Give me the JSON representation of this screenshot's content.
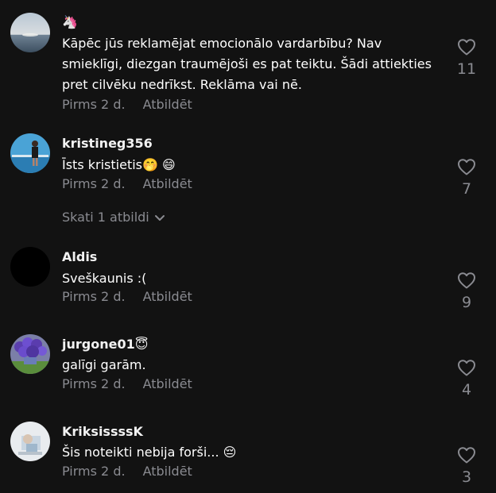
{
  "comments": [
    {
      "username": "🦄",
      "text": "Kāpēc jūs reklamējat emocionālo vardarbību? Nav smieklīgi, diezgan traumējoši es pat teiktu. Šādi attiekties pret cilvēku nedrīkst. Reklāma vai nē.",
      "time": "Pirms 2 d.",
      "reply": "Atbildēt",
      "likes": "11",
      "avatar": "sea-sunset"
    },
    {
      "username": "kristineg356",
      "text": "Īsts kristietis🤭 😄",
      "time": "Pirms 2 d.",
      "reply": "Atbildēt",
      "likes": "7",
      "avatar": "person-by-sea"
    },
    {
      "username": "Aldis",
      "text": "Sveškaunis :(",
      "time": "Pirms 2 d.",
      "reply": "Atbildēt",
      "likes": "9",
      "avatar": "black"
    },
    {
      "username": "jurgone01😇",
      "text": "galīgi garām.",
      "time": "Pirms 2 d.",
      "reply": "Atbildēt",
      "likes": "4",
      "avatar": "purple-flowers"
    },
    {
      "username": "KriksissssK",
      "text": "Šis noteikti nebija forši... 😔",
      "time": "Pirms 2 d.",
      "reply": "Atbildēt",
      "likes": "3",
      "avatar": "light-photo"
    }
  ],
  "view_replies": "Skati 1 atbildi",
  "colors": {
    "background": "#121212",
    "secondary_text": "#8a8b91",
    "primary_text": "#ffffff"
  }
}
